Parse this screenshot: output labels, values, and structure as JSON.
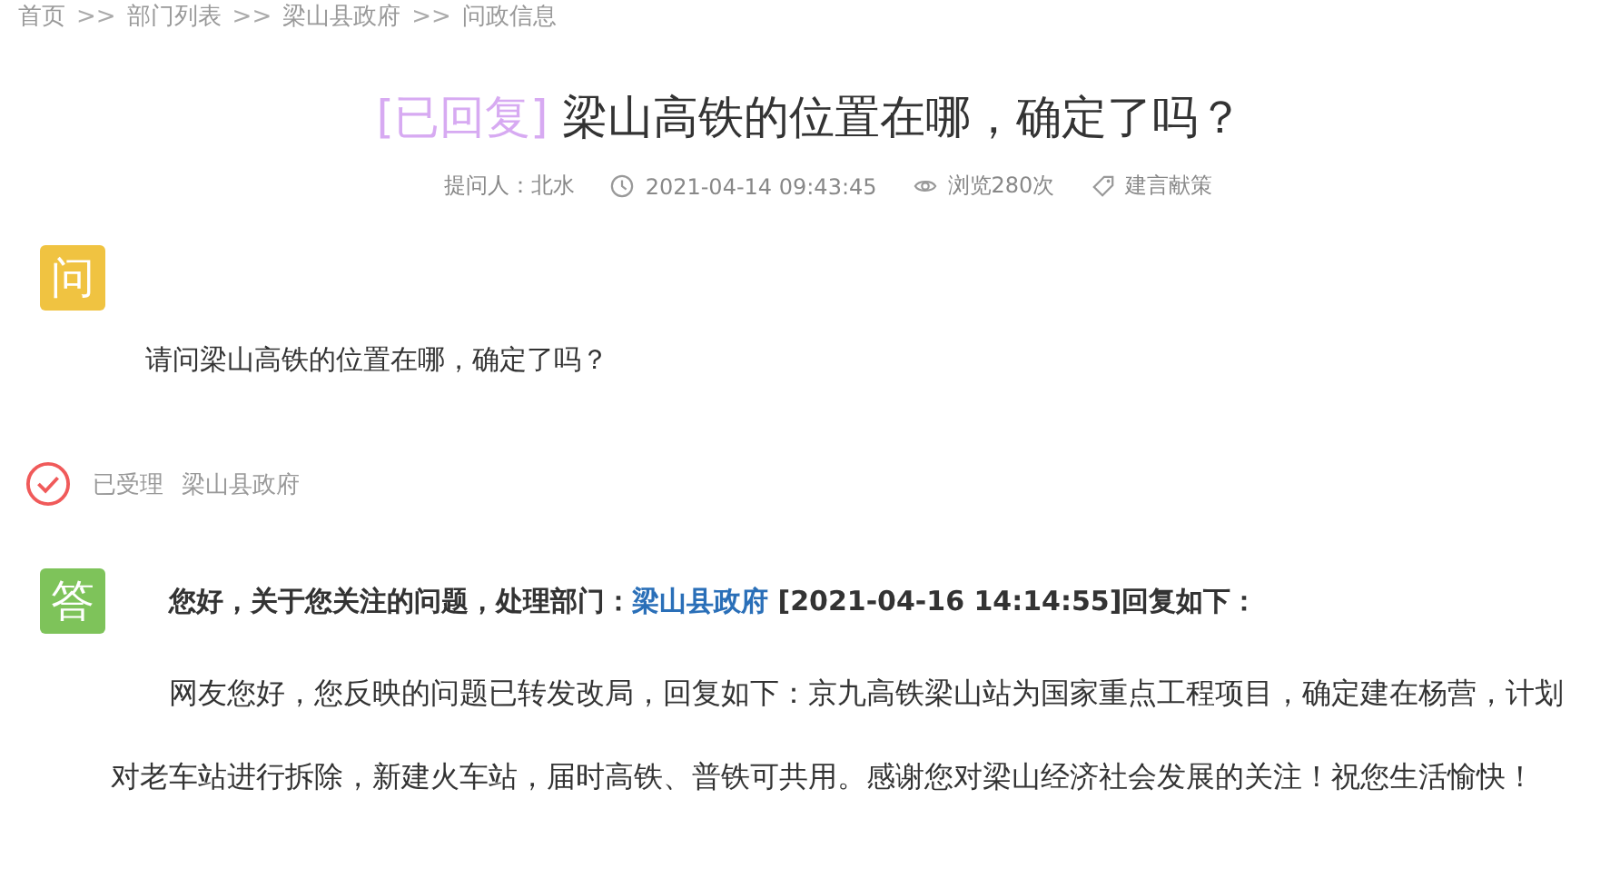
{
  "breadcrumb": [
    {
      "label": "首页",
      "kind": "link"
    },
    {
      "label": ">>",
      "kind": "separator"
    },
    {
      "label": "部门列表",
      "kind": "link"
    },
    {
      "label": ">>",
      "kind": "separator"
    },
    {
      "label": "梁山县政府",
      "kind": "link"
    },
    {
      "label": ">>",
      "kind": "separator"
    },
    {
      "label": "问政信息",
      "kind": "link"
    }
  ],
  "title": {
    "badge": "[已回复]",
    "text": "梁山高铁的位置在哪，确定了吗？"
  },
  "meta": [
    {
      "kind": "asker",
      "text": "提问人：北水"
    },
    {
      "kind": "time",
      "text": "2021-04-14 09:43:45"
    },
    {
      "kind": "views",
      "text": "浏览280次"
    },
    {
      "kind": "category",
      "text": "建言献策"
    }
  ],
  "question": {
    "mark": "问",
    "text": "请问梁山高铁的位置在哪，确定了吗？"
  },
  "status": {
    "accepted": true,
    "label": "已受理",
    "department": "梁山县政府"
  },
  "answer": {
    "mark": "答",
    "heading_prefix": "您好，关于您关注的问题，处理部门：",
    "department": "梁山县政府",
    "heading_suffix": " [2021-04-16 14:14:55]回复如下：",
    "body": "网友您好，您反映的问题已转发改局，回复如下：京九高铁梁山站为国家重点工程项目，确定建在杨营，计划对老车站进行拆除，新建火车站，届时高铁、普铁可共用。感谢您对梁山经济社会发展的关注！祝您生活愉快！"
  }
}
